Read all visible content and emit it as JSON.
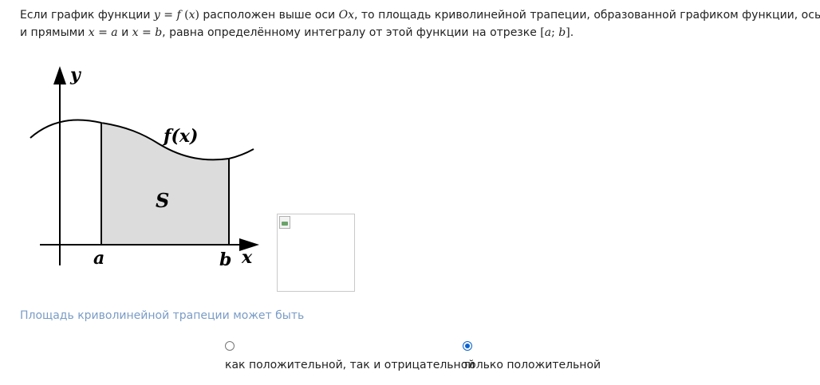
{
  "intro": {
    "p1": "Если график функции ",
    "f_y": "y",
    "f_eq": " = ",
    "f_f": "f",
    "f_open": " (",
    "f_x": "x",
    "f_close": ")",
    "p2": " расположен выше оси ",
    "axis1_O": "O",
    "axis1_x": "x",
    "p3": ", то площадь криволинейной трапеции, образованной графиком функции, осью ",
    "axis2_O": "O",
    "axis2_x": "x",
    "p4": "и прямыми ",
    "xa_x": "x",
    "xa_eq": " = ",
    "xa_a": "a",
    "p5": " и ",
    "xb_x": "x",
    "xb_eq": " = ",
    "xb_b": "b",
    "p6": ", равна определённому интегралу от этой функции на отрезке ",
    "seg_open": "[",
    "seg_a": "a",
    "seg_sep": "; ",
    "seg_b": "b",
    "seg_close": "]",
    "p7": "."
  },
  "figure": {
    "y_label": "y",
    "x_label": "x",
    "func_label": "f(x)",
    "area_label": "S",
    "a_label": "a",
    "b_label": "b",
    "fill_color": "#dcdcdc"
  },
  "question": {
    "text": "Площадь криволинейной трапеции может быть"
  },
  "options": [
    {
      "label": "как положительной, так и отрицательной",
      "selected": false
    },
    {
      "label": "только положительной",
      "selected": true
    }
  ],
  "colors": {
    "question_text": "#7a9cc6",
    "radio_selected": "#0a63d1"
  }
}
